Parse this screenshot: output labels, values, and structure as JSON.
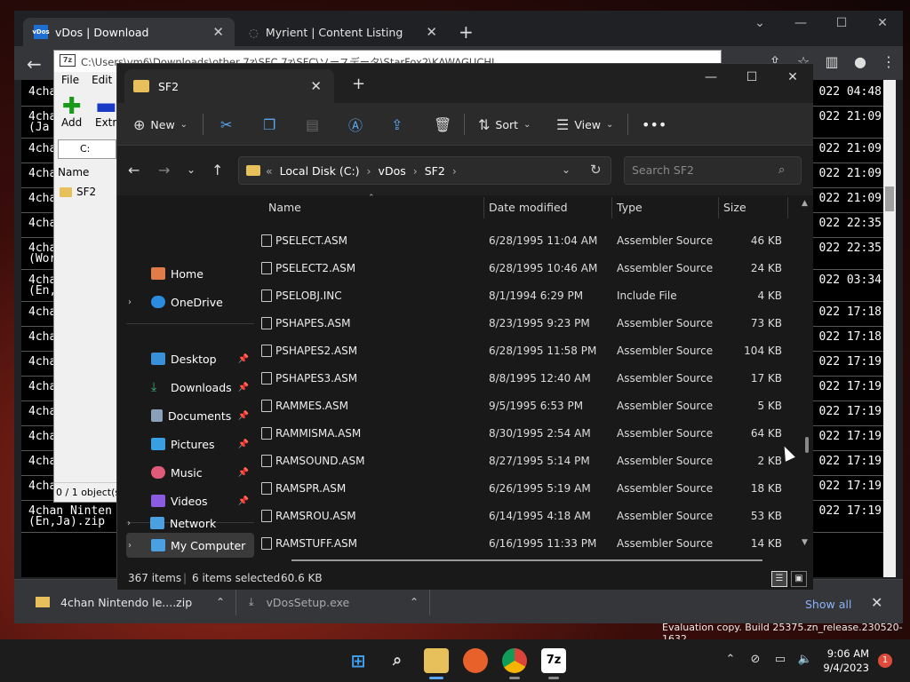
{
  "browser": {
    "tabs": [
      {
        "label": "vDos | Download"
      },
      {
        "label": "Myrient | Content Listing"
      }
    ]
  },
  "terminal": {
    "rows": [
      {
        "l1": "4chan",
        "l2": "",
        "r": "022 04:48"
      },
      {
        "l1": "4chan",
        "l2": "(Ja",
        "r": "022 21:09"
      },
      {
        "l1": "4chan",
        "l2": "",
        "r": "022 21:09"
      },
      {
        "l1": "4chan",
        "l2": "",
        "r": "022 21:09"
      },
      {
        "l1": "4chan",
        "l2": "",
        "r": "022 21:09"
      },
      {
        "l1": "4chan",
        "l2": "",
        "r": "022 22:35"
      },
      {
        "l1": "4chan",
        "l2": "(Wor",
        "r": "022 22:35"
      },
      {
        "l1": "4chan",
        "l2": "(En,",
        "r": "022 03:34"
      },
      {
        "l1": "4chan",
        "l2": "",
        "r": "022 17:18"
      },
      {
        "l1": "4chan",
        "l2": "",
        "r": "022 17:18"
      },
      {
        "l1": "4chan",
        "l2": "",
        "r": "022 17:19"
      },
      {
        "l1": "4chan",
        "l2": "",
        "r": "022 17:19"
      },
      {
        "l1": "4chan",
        "l2": "",
        "r": "022 17:19"
      },
      {
        "l1": "4chan",
        "l2": "",
        "r": "022 17:19"
      },
      {
        "l1": "4chan",
        "l2": "",
        "r": "022 17:19"
      },
      {
        "l1": "4chan Nintend",
        "l2": "",
        "r": "022 17:19"
      },
      {
        "l1": "4chan Ninten",
        "l2": "(En,Ja).zip",
        "r": "022 17:19"
      }
    ]
  },
  "downloads": {
    "items": [
      {
        "label": "4chan Nintendo le....zip"
      },
      {
        "label": "vDosSetup.exe"
      }
    ],
    "show_all": "Show all"
  },
  "zip": {
    "path": "C:\\Users\\vm6\\Downloads\\other 7z\\SFC 7z\\SFC\\ソースデータ\\StarFox2\\KAWAGUCHI",
    "logo": "7z",
    "menu": [
      "File",
      "Edit"
    ],
    "add_label": "Add",
    "extract_label": "Extra",
    "addr": "C:",
    "col_name": "Name",
    "item": "SF2",
    "status": "0 / 1 object(s"
  },
  "explorer": {
    "tab_title": "SF2",
    "cmd": {
      "new": "New",
      "sort": "Sort",
      "view": "View"
    },
    "address": {
      "overflow": "«",
      "crumbs": [
        "Local Disk (C:)",
        "vDos",
        "SF2"
      ]
    },
    "search_placeholder": "Search SF2",
    "nav": {
      "home": "Home",
      "onedrive": "OneDrive",
      "desktop": "Desktop",
      "downloads": "Downloads",
      "documents": "Documents",
      "pictures": "Pictures",
      "music": "Music",
      "videos": "Videos",
      "mycomputer": "My Computer",
      "network": "Network"
    },
    "columns": {
      "name": "Name",
      "date": "Date modified",
      "type": "Type",
      "size": "Size"
    },
    "files": [
      {
        "name": "PSELECT.ASM",
        "date": "6/28/1995 11:04 AM",
        "type": "Assembler Source",
        "size": "46 KB"
      },
      {
        "name": "PSELECT2.ASM",
        "date": "6/28/1995 10:46 AM",
        "type": "Assembler Source",
        "size": "24 KB"
      },
      {
        "name": "PSELOBJ.INC",
        "date": "8/1/1994 6:29 PM",
        "type": "Include File",
        "size": "4 KB"
      },
      {
        "name": "PSHAPES.ASM",
        "date": "8/23/1995 9:23 PM",
        "type": "Assembler Source",
        "size": "73 KB"
      },
      {
        "name": "PSHAPES2.ASM",
        "date": "6/28/1995 11:58 PM",
        "type": "Assembler Source",
        "size": "104 KB"
      },
      {
        "name": "PSHAPES3.ASM",
        "date": "8/8/1995 12:40 AM",
        "type": "Assembler Source",
        "size": "17 KB"
      },
      {
        "name": "RAMMES.ASM",
        "date": "9/5/1995 6:53 PM",
        "type": "Assembler Source",
        "size": "5 KB"
      },
      {
        "name": "RAMMISMA.ASM",
        "date": "8/30/1995 2:54 AM",
        "type": "Assembler Source",
        "size": "64 KB"
      },
      {
        "name": "RAMSOUND.ASM",
        "date": "8/27/1995 5:14 PM",
        "type": "Assembler Source",
        "size": "2 KB"
      },
      {
        "name": "RAMSPR.ASM",
        "date": "6/26/1995 5:19 AM",
        "type": "Assembler Source",
        "size": "18 KB"
      },
      {
        "name": "RAMSROU.ASM",
        "date": "6/14/1995 4:18 AM",
        "type": "Assembler Source",
        "size": "53 KB"
      },
      {
        "name": "RAMSTUFF.ASM",
        "date": "6/16/1995 11:33 PM",
        "type": "Assembler Source",
        "size": "14 KB"
      }
    ],
    "status": {
      "items": "367 items",
      "selected": "6 items selected",
      "size": "60.6 KB"
    }
  },
  "watermark": "Evaluation copy. Build 25375.zn_release.230520-1632",
  "taskbar": {
    "time": "9:06 AM",
    "date": "9/4/2023",
    "notifications": "1",
    "zip_icon": "7z"
  },
  "colors": {
    "accent": "#5aa7f0",
    "folder": "#e7c05b",
    "browser_bg": "#202124",
    "explorer_bg": "#191919"
  }
}
